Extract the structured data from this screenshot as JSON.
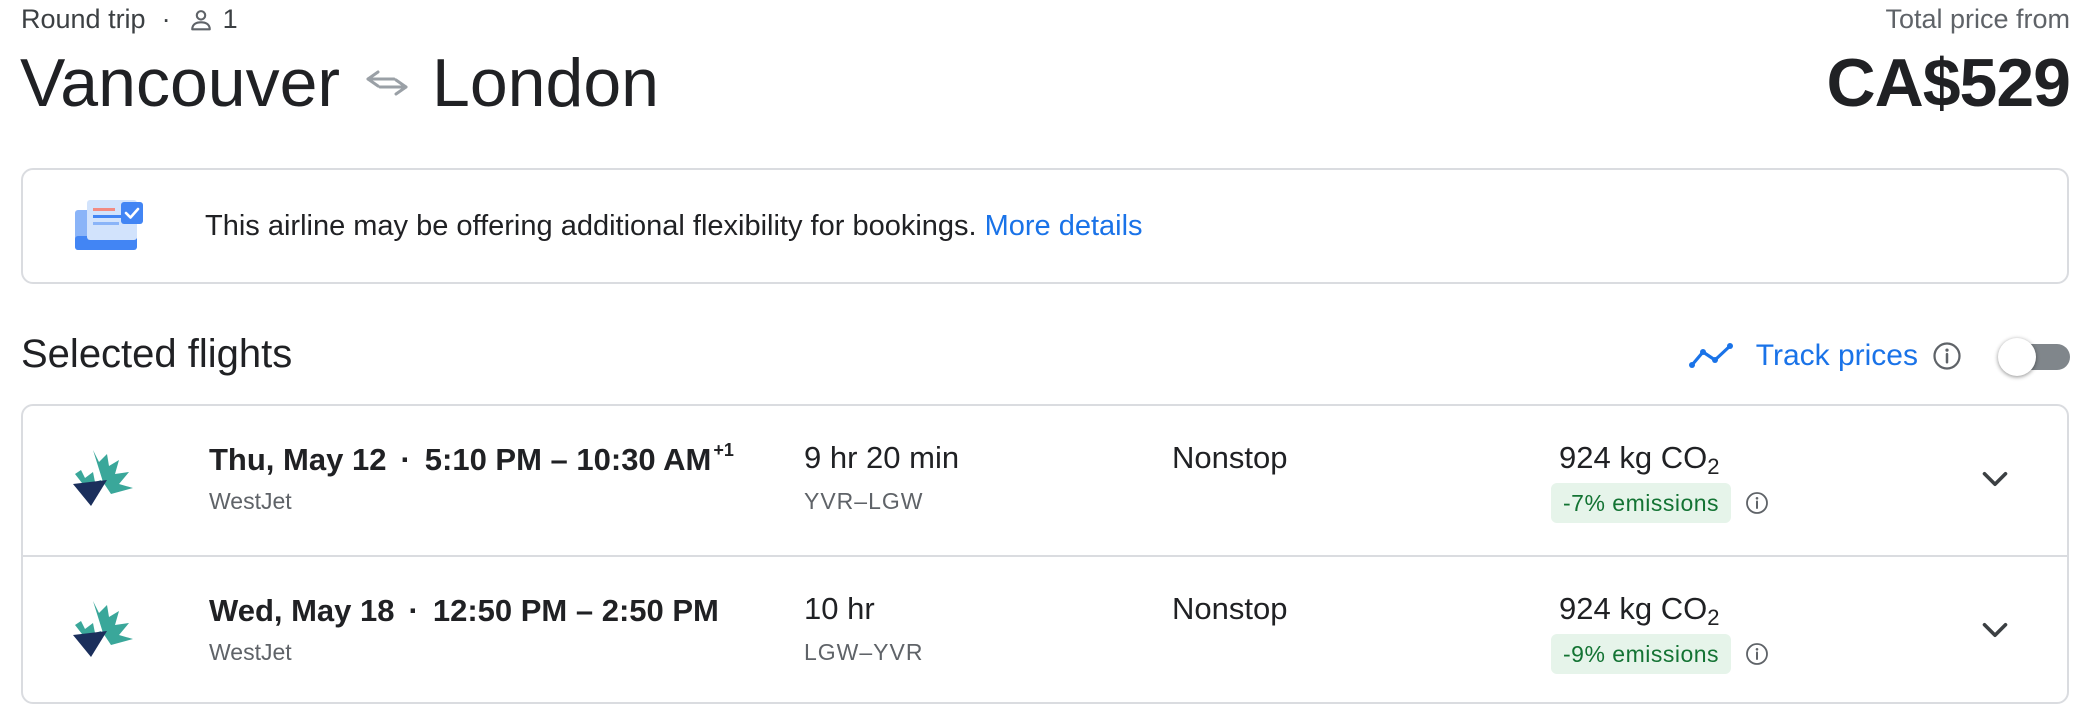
{
  "header": {
    "trip_type": "Round trip",
    "separator": "·",
    "passengers": "1",
    "origin": "Vancouver",
    "destination": "London",
    "price_label": "Total price from",
    "price": "CA$529"
  },
  "notice": {
    "text": "This airline may be offering additional flexibility for bookings.",
    "link": "More details"
  },
  "selected_flights": {
    "title": "Selected flights",
    "track_prices_label": "Track prices",
    "track_prices_enabled": false
  },
  "flights": [
    {
      "date": "Thu, May 12",
      "separator": "·",
      "times": "5:10 PM – 10:30 AM",
      "day_offset": "+1",
      "airline": "WestJet",
      "duration": "9 hr 20 min",
      "airports": "YVR–LGW",
      "stops": "Nonstop",
      "co2": "924 kg CO",
      "co2_sub": "2",
      "emissions": "-7% emissions"
    },
    {
      "date": "Wed, May 18",
      "separator": "·",
      "times": "12:50 PM – 2:50 PM",
      "day_offset": "",
      "airline": "WestJet",
      "duration": "10 hr",
      "airports": "LGW–YVR",
      "stops": "Nonstop",
      "co2": "924 kg CO",
      "co2_sub": "2",
      "emissions": "-9% emissions"
    }
  ],
  "icons": {
    "person": "person-icon",
    "swap": "swap-arrows-icon",
    "notice": "flexible-booking-icon",
    "trend": "price-trend-icon",
    "info": "info-icon",
    "airline_logo": "westjet-logo-icon",
    "expand": "chevron-down-icon"
  },
  "colors": {
    "link_blue": "#1a73e8",
    "text_primary": "#202124",
    "text_secondary": "#5f6368",
    "border": "#dadce0",
    "emissions_badge_bg": "#e6f4ea",
    "emissions_badge_text": "#137333",
    "toggle_rail": "#80868b",
    "westjet_teal": "#3aa79a",
    "westjet_navy": "#1b2f5c"
  }
}
